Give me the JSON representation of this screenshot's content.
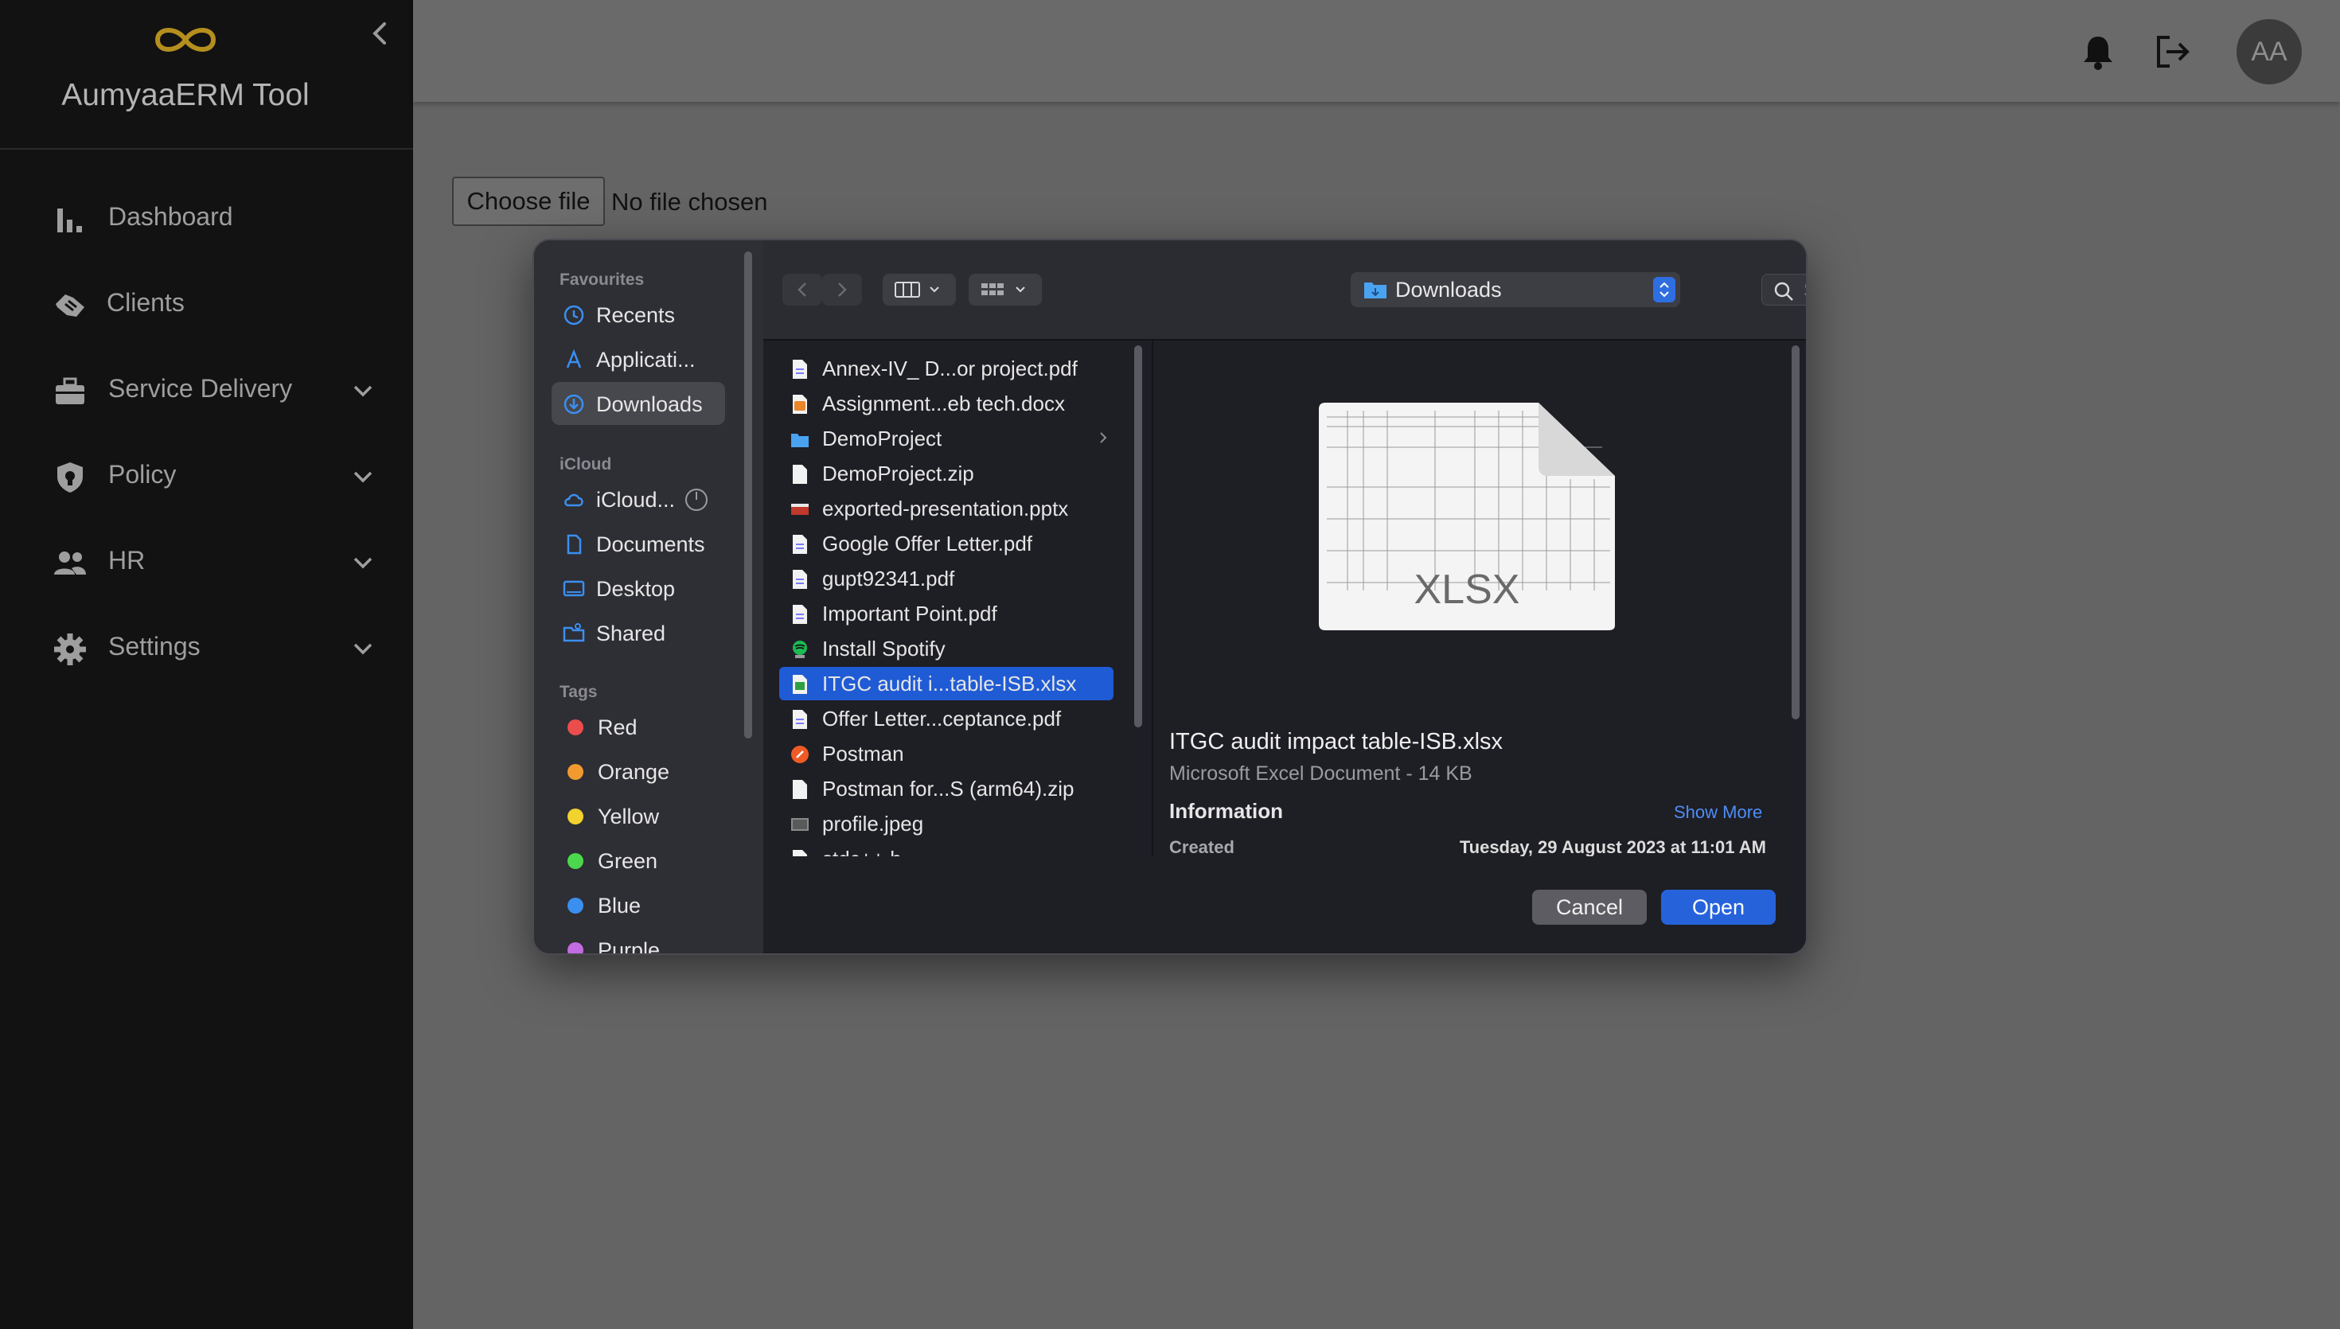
{
  "app": {
    "title": "AumyaaERM Tool",
    "brand_color": "#b58f1e",
    "user_initials": "AA"
  },
  "nav": {
    "items": [
      {
        "label": "Dashboard",
        "icon": "bar-chart-icon",
        "expandable": false
      },
      {
        "label": "Clients",
        "icon": "handshake-icon",
        "expandable": false
      },
      {
        "label": "Service Delivery",
        "icon": "briefcase-icon",
        "expandable": true
      },
      {
        "label": "Policy",
        "icon": "shield-icon",
        "expandable": true
      },
      {
        "label": "HR",
        "icon": "people-icon",
        "expandable": true
      },
      {
        "label": "Settings",
        "icon": "gear-icon",
        "expandable": true
      }
    ]
  },
  "upload": {
    "button_label": "Choose file",
    "status": "No file chosen"
  },
  "dialog": {
    "sidebar": {
      "favourites_header": "Favourites",
      "favourites": [
        "Recents",
        "Applicati...",
        "Downloads"
      ],
      "icloud_header": "iCloud",
      "icloud": [
        "iCloud...",
        "Documents",
        "Desktop",
        "Shared"
      ],
      "tags_header": "Tags",
      "tags": [
        {
          "label": "Red",
          "color": "#eb4d4d"
        },
        {
          "label": "Orange",
          "color": "#f29a2e"
        },
        {
          "label": "Yellow",
          "color": "#f2d22e"
        },
        {
          "label": "Green",
          "color": "#4cd84c"
        },
        {
          "label": "Blue",
          "color": "#3a8ff0"
        },
        {
          "label": "Purple",
          "color": "#c36be0"
        }
      ],
      "active_item": "Downloads"
    },
    "location": "Downloads",
    "search_placeholder": "Search",
    "files": [
      {
        "name": "Annex-IV_ D...or project.pdf",
        "type": "doc"
      },
      {
        "name": "Assignment...eb tech.docx",
        "type": "docx"
      },
      {
        "name": "DemoProject",
        "type": "folder"
      },
      {
        "name": "DemoProject.zip",
        "type": "doc"
      },
      {
        "name": "exported-presentation.pptx",
        "type": "pptx"
      },
      {
        "name": "Google Offer Letter.pdf",
        "type": "doc"
      },
      {
        "name": "gupt92341.pdf",
        "type": "doc"
      },
      {
        "name": "Important Point.pdf",
        "type": "doc"
      },
      {
        "name": "Install Spotify",
        "type": "app"
      },
      {
        "name": "ITGC audit i...table-ISB.xlsx",
        "type": "xlsx",
        "selected": true
      },
      {
        "name": "Offer Letter...ceptance.pdf",
        "type": "doc"
      },
      {
        "name": "Postman",
        "type": "postman"
      },
      {
        "name": "Postman for...S (arm64).zip",
        "type": "doc"
      },
      {
        "name": "profile.jpeg",
        "type": "image"
      },
      {
        "name": "stdc++.h",
        "type": "doc"
      }
    ],
    "preview": {
      "badge": "XLSX",
      "name": "ITGC audit impact table-ISB.xlsx",
      "kind": "Microsoft Excel Document - 14 KB",
      "info_header": "Information",
      "show_more": "Show More",
      "created_label": "Created",
      "created_value": "Tuesday, 29 August 2023 at 11:01 AM"
    },
    "cancel_label": "Cancel",
    "open_label": "Open"
  }
}
